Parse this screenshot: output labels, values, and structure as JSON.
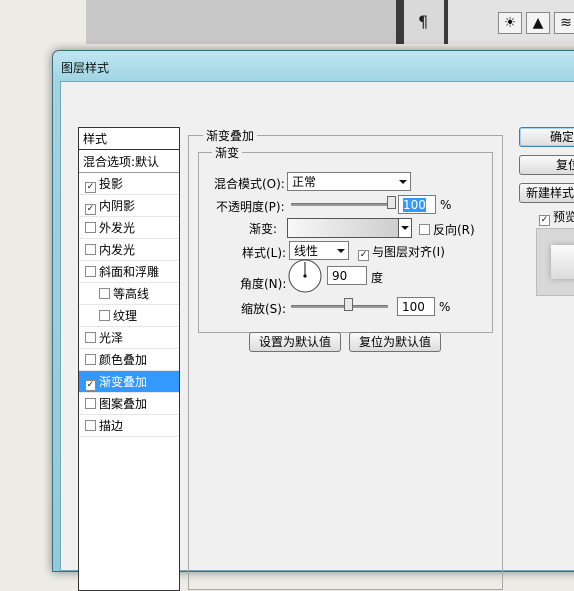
{
  "bg": {
    "paragraph_glyph": "¶",
    "adj_icons": [
      "☀",
      "▲",
      "≋"
    ]
  },
  "dialog": {
    "title": "图层样式",
    "styles_header": "样式",
    "blend_options": "混合选项:默认",
    "styles": [
      {
        "label": "投影",
        "checked": true,
        "selected": false,
        "indent": false
      },
      {
        "label": "内阴影",
        "checked": true,
        "selected": false,
        "indent": false
      },
      {
        "label": "外发光",
        "checked": false,
        "selected": false,
        "indent": false
      },
      {
        "label": "内发光",
        "checked": false,
        "selected": false,
        "indent": false
      },
      {
        "label": "斜面和浮雕",
        "checked": false,
        "selected": false,
        "indent": false
      },
      {
        "label": "等高线",
        "checked": false,
        "selected": false,
        "indent": true
      },
      {
        "label": "纹理",
        "checked": false,
        "selected": false,
        "indent": true
      },
      {
        "label": "光泽",
        "checked": false,
        "selected": false,
        "indent": false
      },
      {
        "label": "颜色叠加",
        "checked": false,
        "selected": false,
        "indent": false
      },
      {
        "label": "渐变叠加",
        "checked": true,
        "selected": true,
        "indent": false
      },
      {
        "label": "图案叠加",
        "checked": false,
        "selected": false,
        "indent": false
      },
      {
        "label": "描边",
        "checked": false,
        "selected": false,
        "indent": false
      }
    ],
    "overlay_group_title": "渐变叠加",
    "gradient_group_title": "渐变",
    "blend_mode_label": "混合模式(O):",
    "blend_mode_value": "正常",
    "opacity_label": "不透明度(P):",
    "opacity_value": "100",
    "opacity_fraction": 1.0,
    "percent": "%",
    "gradient_label": "渐变:",
    "reverse_label": "反向(R)",
    "reverse_checked": false,
    "style_label": "样式(L):",
    "style_value": "线性",
    "align_label": "与图层对齐(I)",
    "align_checked": true,
    "angle_label": "角度(N):",
    "angle_value": "90",
    "angle_unit": "度",
    "scale_label": "缩放(S):",
    "scale_value": "100",
    "scale_fraction": 0.4,
    "set_default_button": "设置为默认值",
    "reset_default_button": "复位为默认值",
    "ok_button": "确定",
    "reset_button": "复位",
    "new_style_button": "新建样式",
    "preview_label": "预览",
    "preview_checked": true,
    "check_glyph": "✓"
  }
}
